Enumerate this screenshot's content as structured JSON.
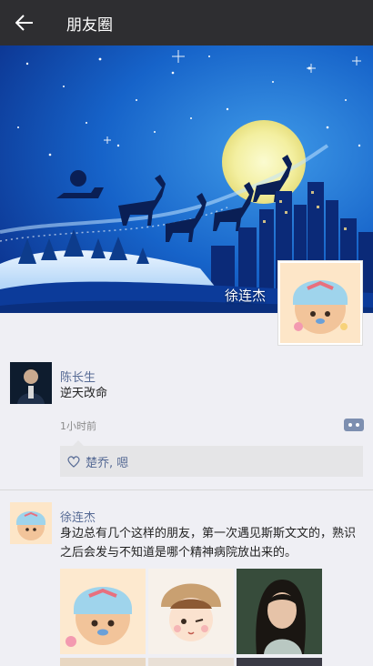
{
  "header": {
    "title": "朋友圈",
    "back_icon": "arrow-left-icon"
  },
  "cover": {
    "owner_name": "徐连杰"
  },
  "posts": [
    {
      "user": "陈长生",
      "text": "逆天改命",
      "time": "1小时前",
      "likes": "楚乔, 嗯"
    },
    {
      "user": "徐连杰",
      "text": "身边总有几个这样的朋友，第一次遇见斯斯文文的，熟识之后会发与不知道是哪个精神病院放出来的。"
    }
  ],
  "colors": {
    "topbar": "#2e2e31",
    "link": "#576b95",
    "bg": "#efeff4"
  }
}
